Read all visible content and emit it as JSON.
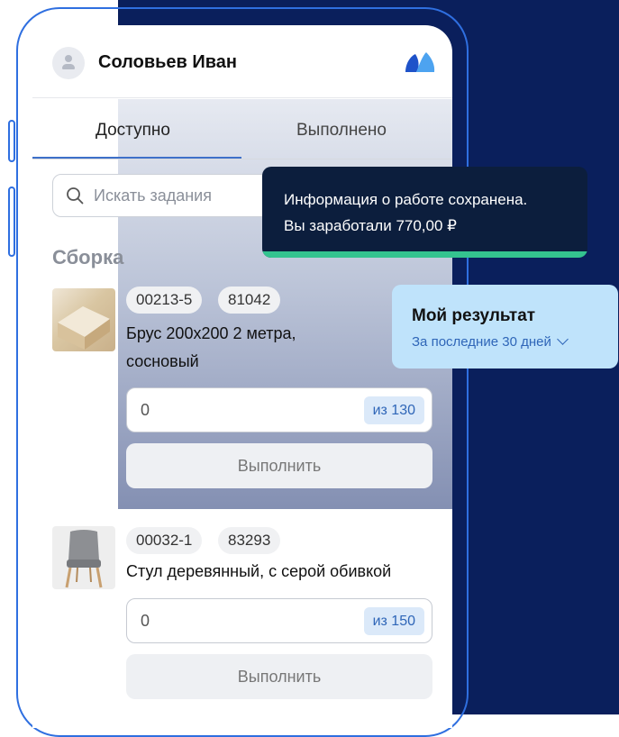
{
  "header": {
    "user_name": "Соловьев Иван"
  },
  "tabs": [
    {
      "label": "Доступно",
      "active": true
    },
    {
      "label": "Выполнено",
      "active": false
    }
  ],
  "search": {
    "placeholder": "Искать задания"
  },
  "section": {
    "title": "Сборка"
  },
  "items": [
    {
      "codes": [
        "00213-5",
        "81042"
      ],
      "title": "Брус 200х200 2 метра, сосновый",
      "qty_value": "0",
      "qty_total": "из 130",
      "action": "Выполнить"
    },
    {
      "codes": [
        "00032-1",
        "83293"
      ],
      "title": "Стул деревянный, с серой обивкой",
      "qty_value": "0",
      "qty_total": "из 150",
      "action": "Выполнить"
    }
  ],
  "toast": {
    "line1": "Информация о работе сохранена.",
    "line2": "Вы заработали 770,00 ₽"
  },
  "result_card": {
    "title": "Мой результат",
    "period": "За последние 30 дней"
  },
  "colors": {
    "navy": "#0a1f5c",
    "accent": "#2f6fe0",
    "toast_bg": "#0c1e3d",
    "success": "#34c38f",
    "result_bg": "#bfe3fb"
  }
}
